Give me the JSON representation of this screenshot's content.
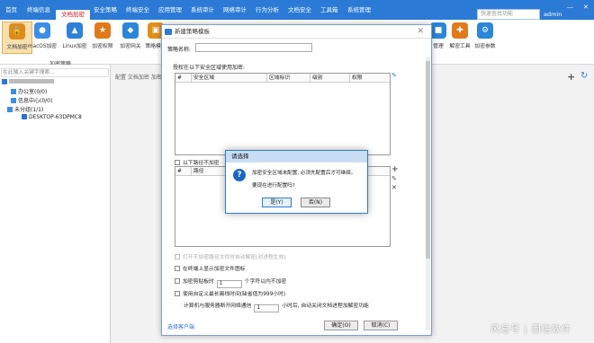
{
  "menu": [
    "首页",
    "终端信息",
    "文档加密",
    "安全策略",
    "终端安全",
    "应用管理",
    "系统审计",
    "网络审计",
    "行为分析",
    "文档安全",
    "工具箱",
    "系统管理"
  ],
  "menu_active_index": 2,
  "search_placeholder": "快速查找功能",
  "admin_label": "admin",
  "ribbon": {
    "buttons": [
      "文档加密",
      "macOS加密",
      "Linux加密",
      "加密权限",
      "加密网关",
      "策略模板"
    ],
    "caption": "加密策略",
    "right_buttons": [
      "管理",
      "解密工具",
      "加密参数"
    ]
  },
  "tree": {
    "search_placeholder": "在此输入关键字搜索...",
    "root": "",
    "items": [
      "办公室(0/0)",
      "信息中心(0/0)",
      "未分组(1/1)",
      "DESKTOP-63DPMC8"
    ]
  },
  "main_tabs": "配置 文档加密 加密",
  "dialog": {
    "title": "新建策略模板",
    "name_label": "策略名称:",
    "name_value": "",
    "auth_label": "授权在以下安全区域使用加密:",
    "table1_headers": [
      "#",
      "安全区域",
      "区域标识",
      "级别",
      "权限"
    ],
    "path_chk": "以下路径不加密",
    "table2_headers": [
      "#",
      "路径"
    ],
    "options": [
      {
        "label": "打开不加密路径文件时自动解密(对进程生效)",
        "checked": false,
        "disabled": true
      },
      {
        "label": "在终端上显示加密文件图标",
        "checked": false,
        "disabled": false
      },
      {
        "label": "加密剪贴板时",
        "checked": false,
        "disabled": false
      },
      {
        "label": "使用自定义最长离线时间(缺省值为999小时)",
        "checked": false,
        "disabled": false
      }
    ],
    "clipboard_suffix": "个字符以内不加密",
    "clipboard_value": "1",
    "offline_prefix": "计算机与服务器断开网络通信",
    "offline_value": "1",
    "offline_suffix": "小时后, 自动关闭文档进程加解密功能",
    "client_link": "选择客户端",
    "ok_label": "确定(O)",
    "cancel_label": "取消(C)"
  },
  "confirm": {
    "title": "请选择",
    "message1": "加密安全区域未配置, 必须先配置后才可继续。",
    "message2": "要现在进行配置吗?",
    "yes_label": "是(Y)",
    "no_label": "否(N)"
  },
  "watermark": "风易号 | 固信软件"
}
